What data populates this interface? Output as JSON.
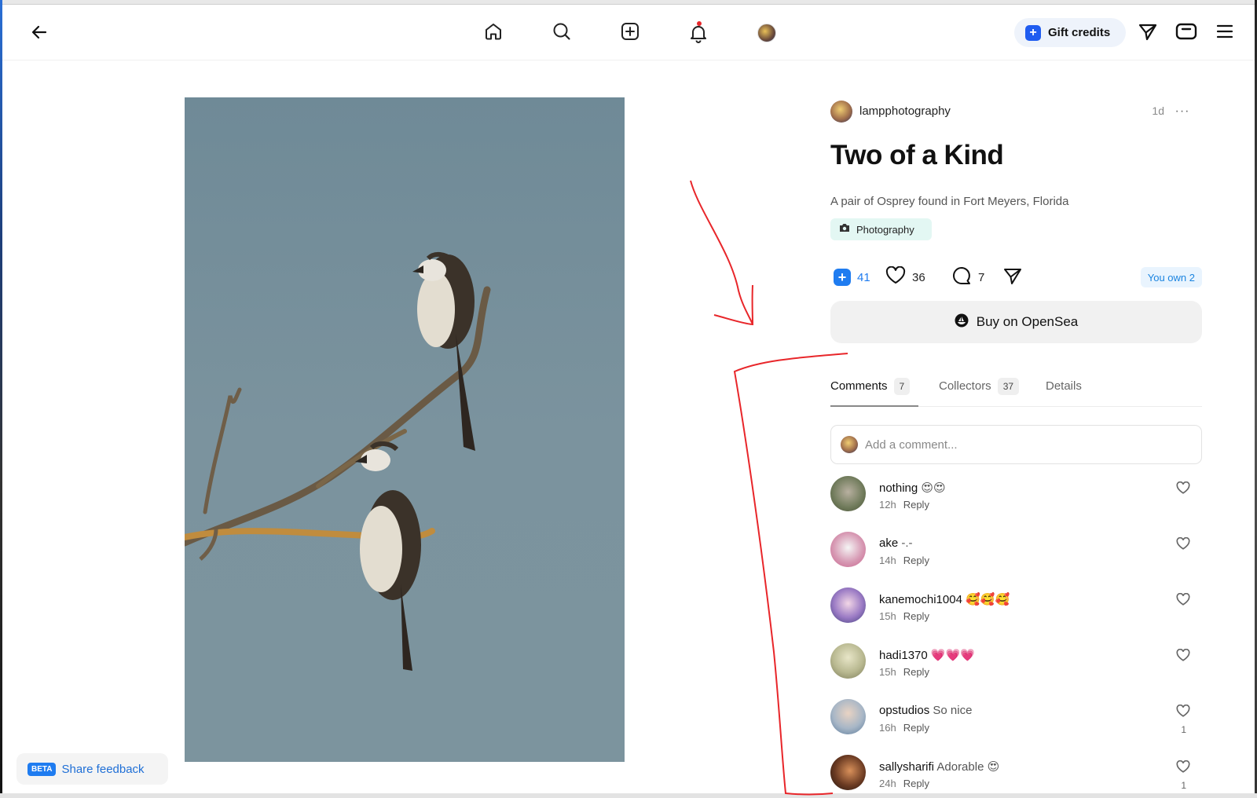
{
  "topbar": {
    "back_icon": "arrow-left-icon",
    "nav": [
      {
        "name": "home",
        "icon": "home-icon"
      },
      {
        "name": "search",
        "icon": "search-icon"
      },
      {
        "name": "create",
        "icon": "plus-square-icon"
      },
      {
        "name": "notifications",
        "icon": "bell-icon",
        "has_dot": true
      },
      {
        "name": "profile",
        "icon": "avatar"
      }
    ],
    "gift_label": "Gift credits",
    "right_icons": [
      "send-icon",
      "wallet-icon",
      "menu-icon"
    ]
  },
  "post": {
    "author": "lampphotography",
    "time": "1d",
    "more": "···",
    "title": "Two of a Kind",
    "description": "A pair of Osprey found in Fort Meyers, Florida",
    "tag": "Photography",
    "collect_count": "41",
    "like_count": "36",
    "comment_count": "7",
    "owned": "You own 2",
    "buy_label": "Buy on OpenSea"
  },
  "tabs": [
    {
      "label": "Comments",
      "count": "7",
      "active": true
    },
    {
      "label": "Collectors",
      "count": "37",
      "active": false
    },
    {
      "label": "Details",
      "count": "",
      "active": false
    }
  ],
  "comment_input": {
    "placeholder": "Add a comment..."
  },
  "comments": [
    {
      "user": "nothing",
      "text": "😍😍",
      "time": "12h",
      "reply": "Reply",
      "likes": ""
    },
    {
      "user": "ake",
      "text": "-.-",
      "time": "14h",
      "reply": "Reply",
      "likes": ""
    },
    {
      "user": "kanemochi1004",
      "text": "🥰🥰🥰",
      "time": "15h",
      "reply": "Reply",
      "likes": ""
    },
    {
      "user": "hadi1370",
      "text": "💗💗💗",
      "time": "15h",
      "reply": "Reply",
      "likes": ""
    },
    {
      "user": "opstudios",
      "text": "So nice",
      "time": "16h",
      "reply": "Reply",
      "likes": "1"
    },
    {
      "user": "sallysharifi",
      "text": "Adorable 😍",
      "time": "24h",
      "reply": "Reply",
      "likes": "1"
    }
  ],
  "feedback": {
    "badge": "BETA",
    "label": "Share feedback"
  },
  "colors": {
    "accent": "#1f7cf0",
    "annotation": "#e8262a",
    "photo_sky": "#7b939e"
  }
}
